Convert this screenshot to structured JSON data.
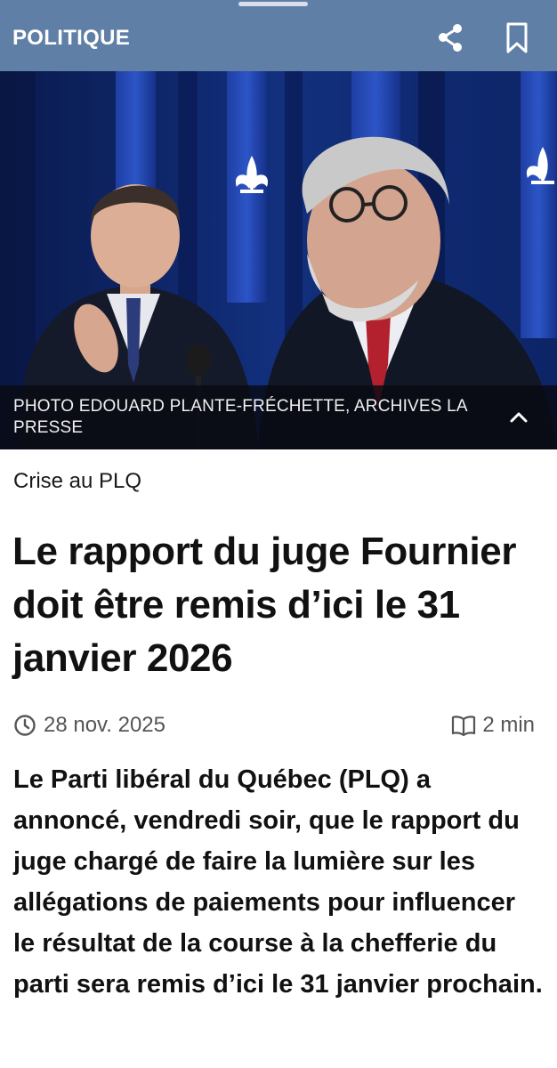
{
  "topbar": {
    "section": "POLITIQUE",
    "share_icon": "share-icon",
    "bookmark_icon": "bookmark-icon",
    "color": "#5f7fa6"
  },
  "photo": {
    "alt": "Deux hommes en complet devant des drapeaux du Québec",
    "credit": "PHOTO EDOUARD PLANTE-FRÉCHETTE, ARCHIVES LA PRESSE",
    "toggle_icon": "chevron-up-icon"
  },
  "article": {
    "kicker": "Crise au PLQ",
    "title": "Le rapport du juge Fournier doit être remis d’ici le 31 janvier 2026",
    "date": "28 nov. 2025",
    "date_icon": "clock-icon",
    "read_time": "2 min",
    "read_icon": "book-icon",
    "lead": "Le Parti libéral du Québec (PLQ) a annoncé, vendredi soir, que le rapport du juge chargé de faire la lumière sur les allégations de paiements pour influencer le résultat de la course à la chefferie du parti sera remis d’ici le 31 janvier prochain."
  }
}
